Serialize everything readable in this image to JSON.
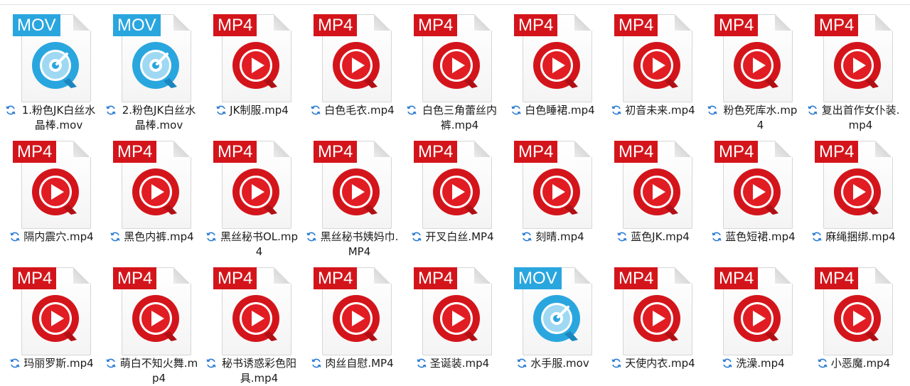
{
  "icons": {
    "mp4_tag_color": "#d3151b",
    "mov_tag_color": "#2aa6df",
    "sync_icon": "sync-pending-icon",
    "mp4_icon": "mp4-play-icon",
    "mov_icon": "quicktime-icon"
  },
  "files": [
    {
      "type": "MOV",
      "name": "1.粉色JK白丝水晶棒.mov"
    },
    {
      "type": "MOV",
      "name": "2.粉色JK白丝水晶棒.mov"
    },
    {
      "type": "MP4",
      "name": "JK制服.mp4"
    },
    {
      "type": "MP4",
      "name": "白色毛衣.mp4"
    },
    {
      "type": "MP4",
      "name": "白色三角蕾丝内裤.mp4"
    },
    {
      "type": "MP4",
      "name": "白色睡裙.mp4"
    },
    {
      "type": "MP4",
      "name": "初音未来.mp4"
    },
    {
      "type": "MP4",
      "name": "粉色死库水.mp4"
    },
    {
      "type": "MP4",
      "name": "复出首作女仆装.mp4"
    },
    {
      "type": "MP4",
      "name": "隔内震穴.mp4"
    },
    {
      "type": "MP4",
      "name": "黑色内裤.mp4"
    },
    {
      "type": "MP4",
      "name": "黑丝秘书OL.mp4"
    },
    {
      "type": "MP4",
      "name": "黑丝秘书姨妈巾.MP4"
    },
    {
      "type": "MP4",
      "name": "开叉白丝.MP4"
    },
    {
      "type": "MP4",
      "name": "刻晴.mp4"
    },
    {
      "type": "MP4",
      "name": "蓝色JK.mp4"
    },
    {
      "type": "MP4",
      "name": "蓝色短裙.mp4"
    },
    {
      "type": "MP4",
      "name": "麻绳捆绑.mp4"
    },
    {
      "type": "MP4",
      "name": "玛丽罗斯.mp4"
    },
    {
      "type": "MP4",
      "name": "萌白不知火舞.mp4"
    },
    {
      "type": "MP4",
      "name": "秘书诱惑彩色阳具.mp4"
    },
    {
      "type": "MP4",
      "name": "肉丝自慰.MP4"
    },
    {
      "type": "MP4",
      "name": "圣诞装.mp4"
    },
    {
      "type": "MOV",
      "name": "水手服.mov"
    },
    {
      "type": "MP4",
      "name": "天使内衣.mp4"
    },
    {
      "type": "MP4",
      "name": "洗澡.mp4"
    },
    {
      "type": "MP4",
      "name": "小恶魔.mp4"
    }
  ]
}
